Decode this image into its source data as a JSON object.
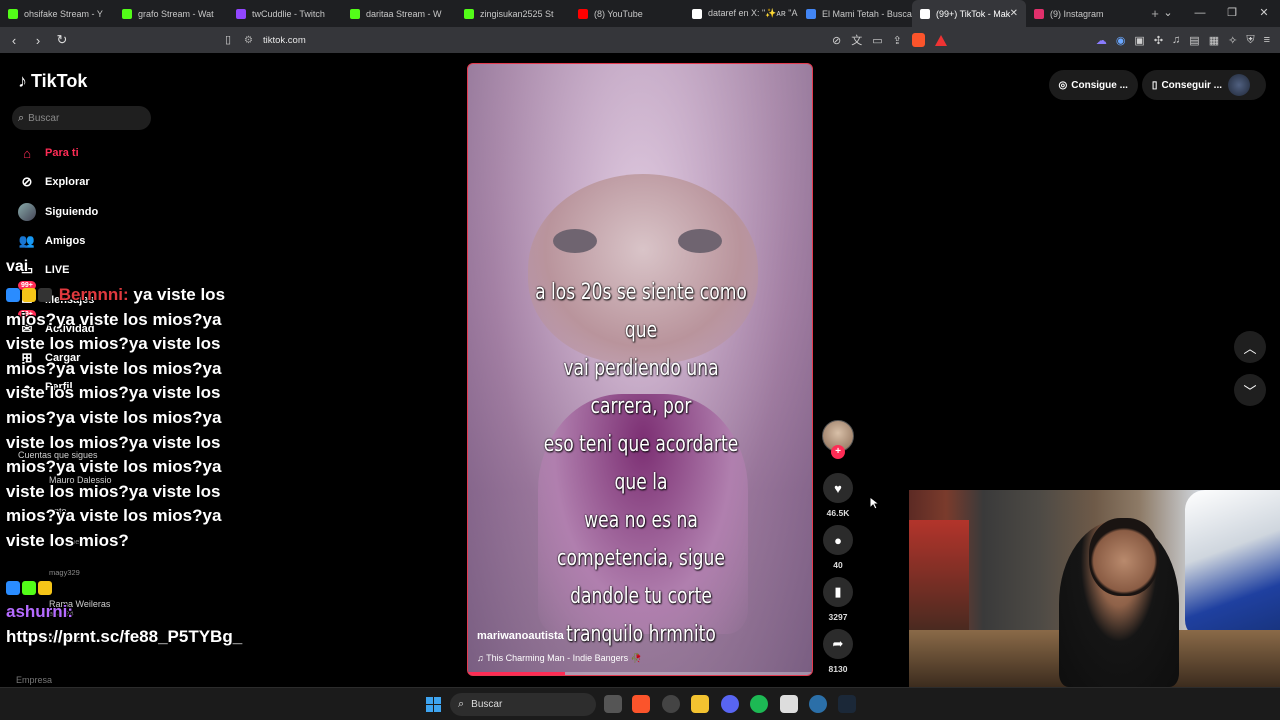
{
  "browser": {
    "tabs": [
      {
        "label": "ohsifake Stream - Y",
        "color": "#53fc18"
      },
      {
        "label": "grafo Stream - Wat",
        "color": "#53fc18"
      },
      {
        "label": "twCuddlie - Twitch",
        "color": "#9146ff"
      },
      {
        "label": "daritaa Stream - W",
        "color": "#53fc18"
      },
      {
        "label": "zingisukan2525 St",
        "color": "#53fc18"
      },
      {
        "label": "(8) YouTube",
        "color": "#ff0000"
      },
      {
        "label": "dataref en X: \"✨ᴀʀ \"A",
        "color": "#ffffff"
      },
      {
        "label": "El Mami Tetah - Buscar",
        "color": "#4285f4"
      },
      {
        "label": "(99+) TikTok - Mak",
        "color": "#ffffff",
        "active": true
      },
      {
        "label": "(9) Instagram",
        "color": "#e1306c"
      }
    ],
    "url": "tiktok.com"
  },
  "tiktok": {
    "logo": "TikTok",
    "search_placeholder": "Buscar",
    "nav": [
      {
        "label": "Para ti",
        "icon": "home-icon",
        "active": true
      },
      {
        "label": "Explorar",
        "icon": "compass-icon"
      },
      {
        "label": "Siguiendo",
        "icon": "following-avatar-icon"
      },
      {
        "label": "Amigos",
        "icon": "friends-icon"
      },
      {
        "label": "LIVE",
        "icon": "live-icon"
      },
      {
        "label": "Mensajes",
        "icon": "messages-icon",
        "badge": "99+"
      },
      {
        "label": "Actividad",
        "icon": "activity-icon",
        "badge": "99+"
      },
      {
        "label": "Cargar",
        "icon": "upload-icon"
      },
      {
        "label": "Perfil",
        "icon": "profile-icon"
      }
    ],
    "following_header": "Cuentas que sigues",
    "following": [
      {
        "name": "Mauro Dalessio",
        "handle": ""
      },
      {
        "name": "anto",
        "handle": ""
      },
      {
        "name": "",
        "handle": "lordejimena"
      },
      {
        "name": "",
        "handle": "magy329"
      },
      {
        "name": "Rama Weileras",
        "handle": "agal.24"
      }
    ],
    "see_all": "Ver todo",
    "company": "Empresa",
    "top_right": {
      "pill1": "Consigue ...",
      "pill2": "Conseguir ..."
    },
    "video": {
      "caption_lines": [
        "a los 20s se siente como que",
        "vai perdiendo una carrera, por",
        "eso teni que acordarte que la",
        "wea no es na competencia, sigue",
        "dandole tu corte tranquilo hrmnito"
      ],
      "author": "mariwanoautista",
      "music": "♫  This Charming Man - Indie Bangers 🥀",
      "progress": 0.28
    },
    "actions": {
      "likes": "46.5K",
      "comments": "40",
      "saves": "3297",
      "shares": "8130"
    }
  },
  "overlay_chat": {
    "line0": "vai",
    "user1": "Bernnni:",
    "msg1": "ya viste los mios?ya viste los mios?ya viste los mios?ya viste los mios?ya viste los mios?ya viste los mios?ya viste los mios?ya viste los mios?ya viste los mios?ya viste los mios?ya viste los mios?ya viste los mios?ya viste los mios?ya viste los mios?ya viste los mios?",
    "user2": "ashurni:",
    "msg2": "https://prnt.sc/fe88_P5TYBg_"
  },
  "taskbar": {
    "search": "Buscar"
  }
}
